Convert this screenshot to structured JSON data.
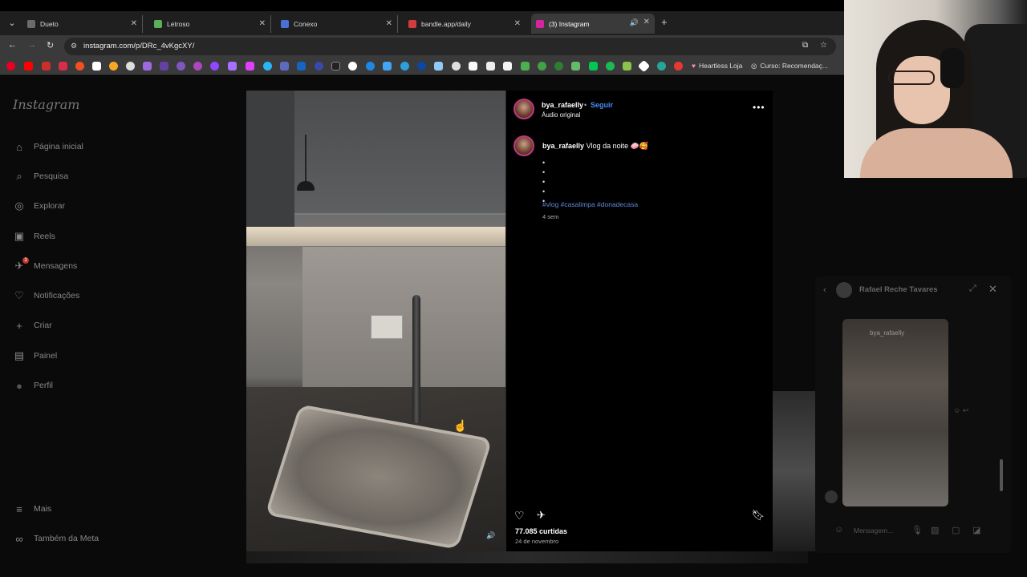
{
  "browser": {
    "tabs": [
      {
        "label": "Dueto",
        "color": "#6b6b6b"
      },
      {
        "label": "Letroso",
        "color": "#5ab05a"
      },
      {
        "label": "Conexo",
        "color": "#4a6fd6"
      },
      {
        "label": "bandle.app/daily",
        "color": "#d23c3c"
      },
      {
        "label": "(3) Instagram",
        "color": "#d6249f"
      }
    ],
    "url": "instagram.com/p/DRc_4vKgcXY/",
    "bookmarks": [
      {
        "label": "Heartless Loja"
      },
      {
        "label": "Curso: Recomendaç..."
      }
    ]
  },
  "instagram": {
    "logo": "Instagram",
    "nav": [
      {
        "label": "Página inicial",
        "icon": "home-icon",
        "glyph": "⌂"
      },
      {
        "label": "Pesquisa",
        "icon": "search-icon",
        "glyph": "⌕"
      },
      {
        "label": "Explorar",
        "icon": "compass-icon",
        "glyph": "◎"
      },
      {
        "label": "Reels",
        "icon": "reels-icon",
        "glyph": "▣"
      },
      {
        "label": "Mensagens",
        "icon": "messages-icon",
        "glyph": "✈",
        "badge": "3"
      },
      {
        "label": "Notificações",
        "icon": "heart-icon",
        "glyph": "♡"
      },
      {
        "label": "Criar",
        "icon": "plus-icon",
        "glyph": "+"
      },
      {
        "label": "Painel",
        "icon": "dashboard-icon",
        "glyph": "▤"
      },
      {
        "label": "Perfil",
        "icon": "avatar-icon",
        "glyph": "●"
      }
    ],
    "nav_bottom": [
      {
        "label": "Mais",
        "icon": "menu-icon",
        "glyph": "≡"
      },
      {
        "label": "Também da Meta",
        "icon": "meta-icon",
        "glyph": "∞"
      }
    ],
    "post": {
      "username": "bya_rafaelly",
      "separator": "•",
      "follow": "Seguir",
      "audio": "Áudio original",
      "caption_user": "bya_rafaelly",
      "caption_text": "Vlog da noite 🧼🥰",
      "bullets": [
        "•",
        "•",
        "•",
        "•",
        "•"
      ],
      "hashtags": "#vlog #casalimpa #donadecasa",
      "age": "4 sem",
      "likes": "77.085 curtidas",
      "date": "24 de novembro"
    },
    "chat": {
      "name": "Rafael Reche Tavares",
      "media_user": "bya_rafaelly",
      "input_placeholder": "Mensagem..."
    }
  }
}
